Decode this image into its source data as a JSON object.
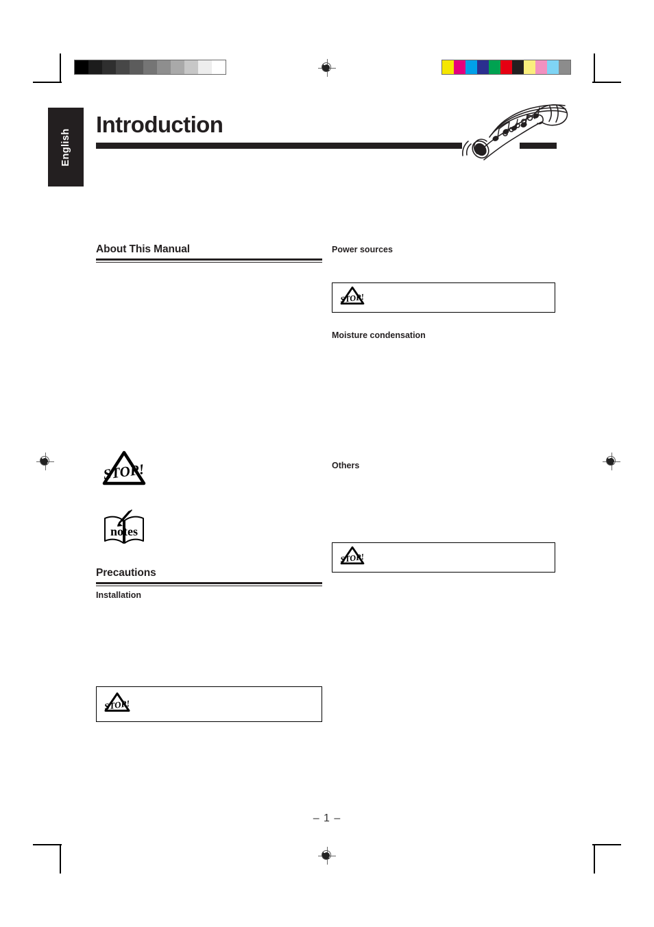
{
  "document": {
    "language_tab": "English",
    "title": "Introduction",
    "page_number": "– 1 –"
  },
  "printmarks": {
    "grayscale_bar": {
      "name": "grayscale-step-wedge",
      "swatches": [
        "#000000",
        "#1c1c1c",
        "#2f2f2f",
        "#474747",
        "#5c5c5c",
        "#757575",
        "#8e8e8e",
        "#a9a9a9",
        "#c7c7c7",
        "#ededed",
        "#ffffff"
      ]
    },
    "color_bar": {
      "name": "process-color-control-bar",
      "swatches": [
        "#f5e600",
        "#e5007e",
        "#00a0e9",
        "#2b2f8f",
        "#00a251",
        "#e60012",
        "#231f20",
        "#faee7d",
        "#f291c0",
        "#7fd4f4",
        "#8c8c8c"
      ]
    },
    "registration_targets": 4,
    "crop_marks": 4
  },
  "artwork": {
    "flute_illustration": "recorder-flute-with-music-notes",
    "stop_icon_label": "STOP!",
    "notes_icon_label": "notes"
  },
  "columns": {
    "left": {
      "sections": [
        {
          "id": "about-this-manual",
          "heading": "About This Manual",
          "type": "ruled-heading"
        },
        {
          "id": "precautions",
          "heading": "Precautions",
          "type": "ruled-heading"
        }
      ],
      "subheadings": [
        {
          "id": "installation",
          "text": "Installation"
        }
      ],
      "icons": [
        {
          "id": "stop-legend",
          "name": "stop-icon",
          "label": "STOP!"
        },
        {
          "id": "notes-legend",
          "name": "notes-icon",
          "label": "notes"
        }
      ],
      "caution_boxes": [
        {
          "id": "installation-caution",
          "icon": "stop-icon"
        }
      ]
    },
    "right": {
      "subheadings": [
        {
          "id": "power-sources",
          "text": "Power sources"
        },
        {
          "id": "moisture-condensation",
          "text": "Moisture condensation"
        },
        {
          "id": "others",
          "text": "Others"
        }
      ],
      "caution_boxes": [
        {
          "id": "power-sources-caution",
          "icon": "stop-icon"
        },
        {
          "id": "others-caution",
          "icon": "stop-icon"
        }
      ]
    }
  }
}
